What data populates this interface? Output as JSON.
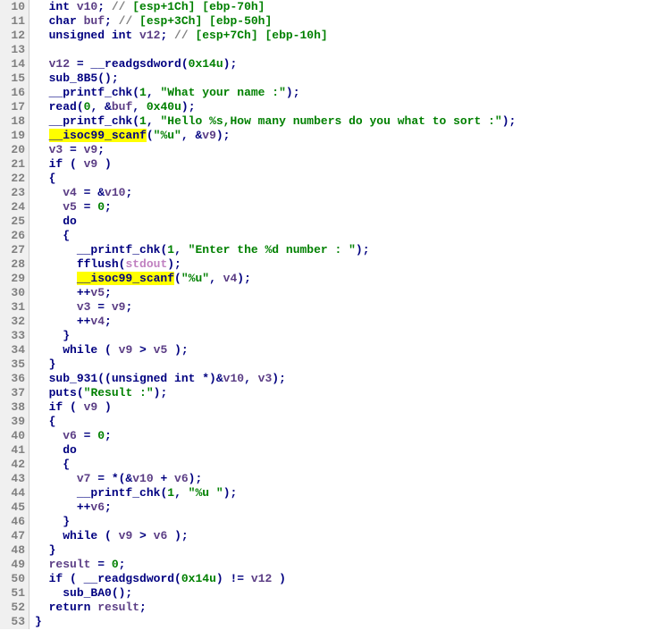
{
  "lines": [
    {
      "n": 10,
      "indent": 1,
      "tokens": [
        {
          "t": "int ",
          "c": "kw"
        },
        {
          "t": "v10",
          "c": "var"
        },
        {
          "t": "; ",
          "c": "op"
        },
        {
          "t": "// ",
          "c": "comment"
        },
        {
          "t": "[esp+1Ch] [ebp-70h]",
          "c": "reg"
        }
      ]
    },
    {
      "n": 11,
      "indent": 1,
      "tokens": [
        {
          "t": "char ",
          "c": "kw"
        },
        {
          "t": "buf",
          "c": "var"
        },
        {
          "t": "; ",
          "c": "op"
        },
        {
          "t": "// ",
          "c": "comment"
        },
        {
          "t": "[esp+3Ch] [ebp-50h]",
          "c": "reg"
        }
      ]
    },
    {
      "n": 12,
      "indent": 1,
      "tokens": [
        {
          "t": "unsigned int ",
          "c": "kw"
        },
        {
          "t": "v12",
          "c": "var"
        },
        {
          "t": "; ",
          "c": "op"
        },
        {
          "t": "// ",
          "c": "comment"
        },
        {
          "t": "[esp+7Ch] [ebp-10h]",
          "c": "reg"
        }
      ]
    },
    {
      "n": 13,
      "indent": 0,
      "tokens": []
    },
    {
      "n": 14,
      "indent": 1,
      "tokens": [
        {
          "t": "v12",
          "c": "var"
        },
        {
          "t": " = ",
          "c": "op"
        },
        {
          "t": "__readgsdword",
          "c": "func"
        },
        {
          "t": "(",
          "c": "op"
        },
        {
          "t": "0x14u",
          "c": "num"
        },
        {
          "t": ");",
          "c": "op"
        }
      ]
    },
    {
      "n": 15,
      "indent": 1,
      "tokens": [
        {
          "t": "sub_8B5",
          "c": "func"
        },
        {
          "t": "();",
          "c": "op"
        }
      ]
    },
    {
      "n": 16,
      "indent": 1,
      "tokens": [
        {
          "t": "__printf_chk",
          "c": "func"
        },
        {
          "t": "(",
          "c": "op"
        },
        {
          "t": "1",
          "c": "num"
        },
        {
          "t": ", ",
          "c": "op"
        },
        {
          "t": "\"What your name :\"",
          "c": "str"
        },
        {
          "t": ");",
          "c": "op"
        }
      ]
    },
    {
      "n": 17,
      "indent": 1,
      "tokens": [
        {
          "t": "read",
          "c": "func"
        },
        {
          "t": "(",
          "c": "op"
        },
        {
          "t": "0",
          "c": "num"
        },
        {
          "t": ", &",
          "c": "op"
        },
        {
          "t": "buf",
          "c": "var"
        },
        {
          "t": ", ",
          "c": "op"
        },
        {
          "t": "0x40u",
          "c": "num"
        },
        {
          "t": ");",
          "c": "op"
        }
      ]
    },
    {
      "n": 18,
      "indent": 1,
      "tokens": [
        {
          "t": "__printf_chk",
          "c": "func"
        },
        {
          "t": "(",
          "c": "op"
        },
        {
          "t": "1",
          "c": "num"
        },
        {
          "t": ", ",
          "c": "op"
        },
        {
          "t": "\"Hello %s,How many numbers do you what to sort :\"",
          "c": "str"
        },
        {
          "t": ");",
          "c": "op"
        }
      ]
    },
    {
      "n": 19,
      "indent": 1,
      "tokens": [
        {
          "t": "__isoc99_scanf",
          "c": "hilite"
        },
        {
          "t": "(",
          "c": "op"
        },
        {
          "t": "\"%u\"",
          "c": "str"
        },
        {
          "t": ", &",
          "c": "op"
        },
        {
          "t": "v9",
          "c": "var"
        },
        {
          "t": ");",
          "c": "op"
        }
      ]
    },
    {
      "n": 20,
      "indent": 1,
      "tokens": [
        {
          "t": "v3",
          "c": "var"
        },
        {
          "t": " = ",
          "c": "op"
        },
        {
          "t": "v9",
          "c": "var"
        },
        {
          "t": ";",
          "c": "op"
        }
      ]
    },
    {
      "n": 21,
      "indent": 1,
      "tokens": [
        {
          "t": "if ",
          "c": "kw"
        },
        {
          "t": "( ",
          "c": "op"
        },
        {
          "t": "v9",
          "c": "var"
        },
        {
          "t": " )",
          "c": "op"
        }
      ]
    },
    {
      "n": 22,
      "indent": 1,
      "tokens": [
        {
          "t": "{",
          "c": "op"
        }
      ]
    },
    {
      "n": 23,
      "indent": 2,
      "tokens": [
        {
          "t": "v4",
          "c": "var"
        },
        {
          "t": " = &",
          "c": "op"
        },
        {
          "t": "v10",
          "c": "var"
        },
        {
          "t": ";",
          "c": "op"
        }
      ]
    },
    {
      "n": 24,
      "indent": 2,
      "tokens": [
        {
          "t": "v5",
          "c": "var"
        },
        {
          "t": " = ",
          "c": "op"
        },
        {
          "t": "0",
          "c": "num"
        },
        {
          "t": ";",
          "c": "op"
        }
      ]
    },
    {
      "n": 25,
      "indent": 2,
      "tokens": [
        {
          "t": "do",
          "c": "kw"
        }
      ]
    },
    {
      "n": 26,
      "indent": 2,
      "tokens": [
        {
          "t": "{",
          "c": "op"
        }
      ]
    },
    {
      "n": 27,
      "indent": 3,
      "tokens": [
        {
          "t": "__printf_chk",
          "c": "func"
        },
        {
          "t": "(",
          "c": "op"
        },
        {
          "t": "1",
          "c": "num"
        },
        {
          "t": ", ",
          "c": "op"
        },
        {
          "t": "\"Enter the %d number : \"",
          "c": "str"
        },
        {
          "t": ");",
          "c": "op"
        }
      ]
    },
    {
      "n": 28,
      "indent": 3,
      "tokens": [
        {
          "t": "fflush",
          "c": "func"
        },
        {
          "t": "(",
          "c": "op"
        },
        {
          "t": "stdout",
          "c": "ptr"
        },
        {
          "t": ");",
          "c": "op"
        }
      ]
    },
    {
      "n": 29,
      "indent": 3,
      "tokens": [
        {
          "t": "__isoc99_scanf",
          "c": "hilite"
        },
        {
          "t": "(",
          "c": "op"
        },
        {
          "t": "\"%u\"",
          "c": "str"
        },
        {
          "t": ", ",
          "c": "op"
        },
        {
          "t": "v4",
          "c": "var"
        },
        {
          "t": ");",
          "c": "op"
        }
      ]
    },
    {
      "n": 30,
      "indent": 3,
      "tokens": [
        {
          "t": "++",
          "c": "op"
        },
        {
          "t": "v5",
          "c": "var"
        },
        {
          "t": ";",
          "c": "op"
        }
      ]
    },
    {
      "n": 31,
      "indent": 3,
      "tokens": [
        {
          "t": "v3",
          "c": "var"
        },
        {
          "t": " = ",
          "c": "op"
        },
        {
          "t": "v9",
          "c": "var"
        },
        {
          "t": ";",
          "c": "op"
        }
      ]
    },
    {
      "n": 32,
      "indent": 3,
      "tokens": [
        {
          "t": "++",
          "c": "op"
        },
        {
          "t": "v4",
          "c": "var"
        },
        {
          "t": ";",
          "c": "op"
        }
      ]
    },
    {
      "n": 33,
      "indent": 2,
      "tokens": [
        {
          "t": "}",
          "c": "op"
        }
      ]
    },
    {
      "n": 34,
      "indent": 2,
      "tokens": [
        {
          "t": "while ",
          "c": "kw"
        },
        {
          "t": "( ",
          "c": "op"
        },
        {
          "t": "v9",
          "c": "var"
        },
        {
          "t": " > ",
          "c": "op"
        },
        {
          "t": "v5",
          "c": "var"
        },
        {
          "t": " );",
          "c": "op"
        }
      ]
    },
    {
      "n": 35,
      "indent": 1,
      "tokens": [
        {
          "t": "}",
          "c": "op"
        }
      ]
    },
    {
      "n": 36,
      "indent": 1,
      "tokens": [
        {
          "t": "sub_931",
          "c": "func"
        },
        {
          "t": "((",
          "c": "op"
        },
        {
          "t": "unsigned int ",
          "c": "kw"
        },
        {
          "t": "*)&",
          "c": "op"
        },
        {
          "t": "v10",
          "c": "var"
        },
        {
          "t": ", ",
          "c": "op"
        },
        {
          "t": "v3",
          "c": "var"
        },
        {
          "t": ");",
          "c": "op"
        }
      ]
    },
    {
      "n": 37,
      "indent": 1,
      "tokens": [
        {
          "t": "puts",
          "c": "func"
        },
        {
          "t": "(",
          "c": "op"
        },
        {
          "t": "\"Result :\"",
          "c": "str"
        },
        {
          "t": ");",
          "c": "op"
        }
      ]
    },
    {
      "n": 38,
      "indent": 1,
      "tokens": [
        {
          "t": "if ",
          "c": "kw"
        },
        {
          "t": "( ",
          "c": "op"
        },
        {
          "t": "v9",
          "c": "var"
        },
        {
          "t": " )",
          "c": "op"
        }
      ]
    },
    {
      "n": 39,
      "indent": 1,
      "tokens": [
        {
          "t": "{",
          "c": "op"
        }
      ]
    },
    {
      "n": 40,
      "indent": 2,
      "tokens": [
        {
          "t": "v6",
          "c": "var"
        },
        {
          "t": " = ",
          "c": "op"
        },
        {
          "t": "0",
          "c": "num"
        },
        {
          "t": ";",
          "c": "op"
        }
      ]
    },
    {
      "n": 41,
      "indent": 2,
      "tokens": [
        {
          "t": "do",
          "c": "kw"
        }
      ]
    },
    {
      "n": 42,
      "indent": 2,
      "tokens": [
        {
          "t": "{",
          "c": "op"
        }
      ]
    },
    {
      "n": 43,
      "indent": 3,
      "tokens": [
        {
          "t": "v7",
          "c": "var"
        },
        {
          "t": " = *(&",
          "c": "op"
        },
        {
          "t": "v10",
          "c": "var"
        },
        {
          "t": " + ",
          "c": "op"
        },
        {
          "t": "v6",
          "c": "var"
        },
        {
          "t": ");",
          "c": "op"
        }
      ]
    },
    {
      "n": 44,
      "indent": 3,
      "tokens": [
        {
          "t": "__printf_chk",
          "c": "func"
        },
        {
          "t": "(",
          "c": "op"
        },
        {
          "t": "1",
          "c": "num"
        },
        {
          "t": ", ",
          "c": "op"
        },
        {
          "t": "\"%u \"",
          "c": "str"
        },
        {
          "t": ");",
          "c": "op"
        }
      ]
    },
    {
      "n": 45,
      "indent": 3,
      "tokens": [
        {
          "t": "++",
          "c": "op"
        },
        {
          "t": "v6",
          "c": "var"
        },
        {
          "t": ";",
          "c": "op"
        }
      ]
    },
    {
      "n": 46,
      "indent": 2,
      "tokens": [
        {
          "t": "}",
          "c": "op"
        }
      ]
    },
    {
      "n": 47,
      "indent": 2,
      "tokens": [
        {
          "t": "while ",
          "c": "kw"
        },
        {
          "t": "( ",
          "c": "op"
        },
        {
          "t": "v9",
          "c": "var"
        },
        {
          "t": " > ",
          "c": "op"
        },
        {
          "t": "v6",
          "c": "var"
        },
        {
          "t": " );",
          "c": "op"
        }
      ]
    },
    {
      "n": 48,
      "indent": 1,
      "tokens": [
        {
          "t": "}",
          "c": "op"
        }
      ]
    },
    {
      "n": 49,
      "indent": 1,
      "tokens": [
        {
          "t": "result",
          "c": "var"
        },
        {
          "t": " = ",
          "c": "op"
        },
        {
          "t": "0",
          "c": "num"
        },
        {
          "t": ";",
          "c": "op"
        }
      ]
    },
    {
      "n": 50,
      "indent": 1,
      "tokens": [
        {
          "t": "if ",
          "c": "kw"
        },
        {
          "t": "( ",
          "c": "op"
        },
        {
          "t": "__readgsdword",
          "c": "func"
        },
        {
          "t": "(",
          "c": "op"
        },
        {
          "t": "0x14u",
          "c": "num"
        },
        {
          "t": ") != ",
          "c": "op"
        },
        {
          "t": "v12",
          "c": "var"
        },
        {
          "t": " )",
          "c": "op"
        }
      ]
    },
    {
      "n": 51,
      "indent": 2,
      "tokens": [
        {
          "t": "sub_BA0",
          "c": "func"
        },
        {
          "t": "();",
          "c": "op"
        }
      ]
    },
    {
      "n": 52,
      "indent": 1,
      "tokens": [
        {
          "t": "return ",
          "c": "kw"
        },
        {
          "t": "result",
          "c": "var"
        },
        {
          "t": ";",
          "c": "op"
        }
      ]
    },
    {
      "n": 53,
      "indent": 0,
      "tokens": [
        {
          "t": "}",
          "c": "op"
        }
      ]
    }
  ]
}
